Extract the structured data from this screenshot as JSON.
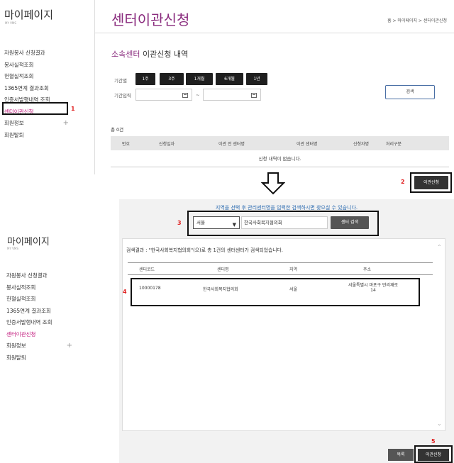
{
  "header": {
    "logo_title": "마이페이지",
    "logo_sub": "MY VMS",
    "page_title": "센터이관신청",
    "breadcrumb": "홈 > 마이페이지 > 센터이관신청"
  },
  "sidebar": {
    "items": [
      {
        "label": "자원봉사 신청결과"
      },
      {
        "label": "봉사실적조회"
      },
      {
        "label": "헌혈실적조회"
      },
      {
        "label": "1365연계 결과조회"
      },
      {
        "label": "인증서발행내역 조회"
      },
      {
        "label": "센터이관신청"
      },
      {
        "label": "회원정보",
        "plus": "+"
      },
      {
        "label": "회원탈퇴"
      }
    ]
  },
  "section": {
    "title_highlight": "소속센터",
    "title_rest": " 이관신청 내역"
  },
  "filter": {
    "period_label": "기간별",
    "period_buttons": [
      "1주",
      "3주",
      "1개월",
      "6개월",
      "1년"
    ],
    "date_label": "기간입력",
    "tilde": "~",
    "search_label": "검색"
  },
  "list": {
    "total": "총 0건",
    "columns": [
      "번호",
      "신청일자",
      "이관 전 센터명",
      "이관 센터명",
      "신청자명",
      "처리구분"
    ],
    "empty_message": "신청 내역이 없습니다."
  },
  "top_transfer_button": "이관신청",
  "markers": [
    "1",
    "2",
    "3",
    "4",
    "5"
  ],
  "popup": {
    "notice": "지역을 선택 후 관리센터명을 입력한 검색하시면 찾으실 수 있습니다.",
    "region_value": "서울",
    "center_input_value": "한국사회복지협의회",
    "center_search_label": "센터 검색",
    "result_message": "검색결과 : \"한국사회복지협의회\"(으)로 총 1건의 센터센터가 검색되었습니다.",
    "columns": [
      "센터코드",
      "센터명",
      "지역",
      "주소"
    ],
    "rows": [
      {
        "code": "10000178",
        "name": "한국사회복지협의회",
        "region": "서울",
        "address_line1": "서울특별시 마포구 만리재로",
        "address_line2": "14"
      }
    ],
    "list_button": "목록",
    "transfer_button": "이관신청"
  },
  "sidebar2": {
    "logo_title": "마이페이지",
    "logo_sub": "MY VMS",
    "items": [
      {
        "label": "자원봉사 신청결과"
      },
      {
        "label": "봉사실적조회"
      },
      {
        "label": "헌혈실적조회"
      },
      {
        "label": "1365연계 결과조회"
      },
      {
        "label": "인증서발행내역 조회"
      },
      {
        "label": "센터이관신청"
      },
      {
        "label": "회원정보",
        "plus": "+"
      },
      {
        "label": "회원탈퇴"
      }
    ]
  },
  "colors": {
    "accent": "#8a2c7e",
    "active_menu": "#c0157a",
    "marker_red": "#e02020",
    "dark_button": "#1f1f1f",
    "notice_blue": "#2a6ab0"
  }
}
